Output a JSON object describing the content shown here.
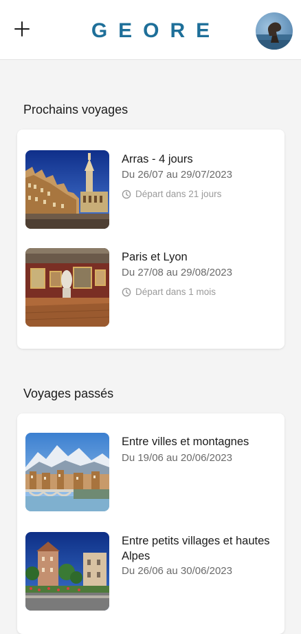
{
  "header": {
    "logo": "GEORE",
    "add_icon": "plus-icon",
    "avatar": "profile-avatar"
  },
  "upcoming": {
    "title": "Prochains voyages",
    "trips": [
      {
        "title": "Arras - 4 jours",
        "dates": "Du 26/07 au 29/07/2023",
        "depart": "Départ dans 21 jours"
      },
      {
        "title": "Paris et Lyon",
        "dates": "Du 27/08 au 29/08/2023",
        "depart": "Départ dans 1 mois"
      }
    ]
  },
  "past": {
    "title": "Voyages passés",
    "trips": [
      {
        "title": "Entre villes et montagnes",
        "dates": "Du 19/06 au 20/06/2023"
      },
      {
        "title": "Entre petits villages et hautes Alpes",
        "dates": "Du 26/06 au 30/06/2023"
      }
    ]
  },
  "colors": {
    "brand": "#1e6f99",
    "background": "#f4f4f4",
    "card": "#ffffff"
  }
}
